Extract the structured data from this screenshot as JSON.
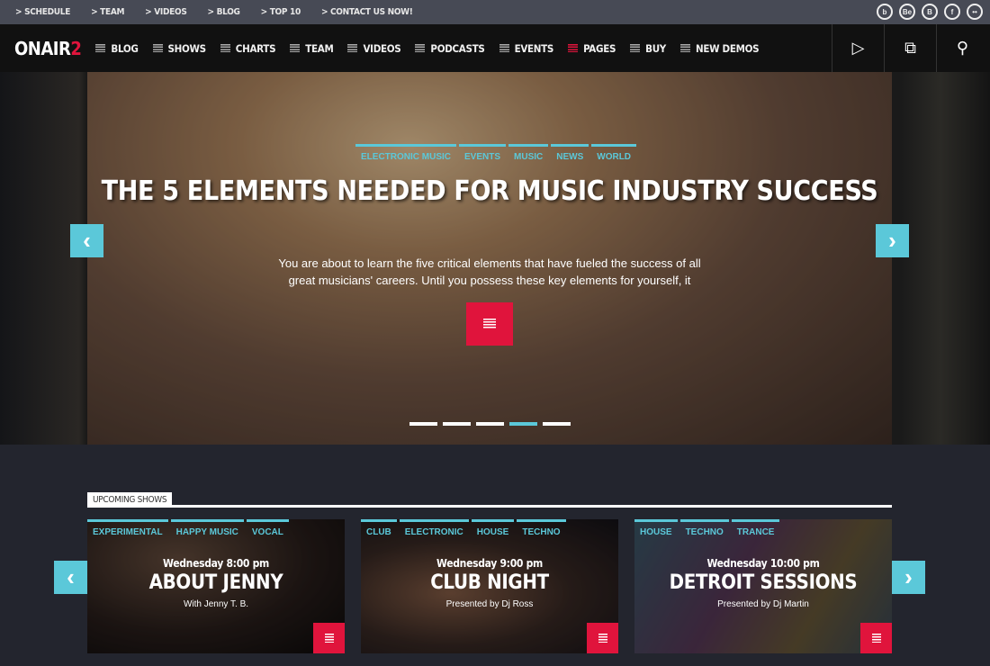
{
  "topbar": {
    "links": [
      "> SCHEDULE",
      "> TEAM",
      "> VIDEOS",
      "> BLOG",
      "> TOP 10",
      "> CONTACT US NOW!"
    ],
    "socials": [
      {
        "icon": "b-icon",
        "glyph": "b"
      },
      {
        "icon": "behance-icon",
        "glyph": "Be"
      },
      {
        "icon": "blogger-icon",
        "glyph": "B"
      },
      {
        "icon": "facebook-icon",
        "glyph": "f"
      },
      {
        "icon": "flickr-icon",
        "glyph": "••"
      }
    ]
  },
  "nav": {
    "logo_main": "ONAIR",
    "logo_accent": "2",
    "items": [
      "BLOG",
      "SHOWS",
      "CHARTS",
      "TEAM",
      "VIDEOS",
      "PODCASTS",
      "EVENTS",
      "PAGES",
      "BUY",
      "NEW DEMOS"
    ],
    "active": "PAGES",
    "buttons": [
      {
        "icon": "play-icon",
        "glyph": "▷"
      },
      {
        "icon": "copy-icon",
        "glyph": "⧉"
      },
      {
        "icon": "search-icon",
        "glyph": "⚲"
      }
    ]
  },
  "hero": {
    "tags": [
      "ELECTRONIC MUSIC",
      "EVENTS",
      "MUSIC",
      "NEWS",
      "WORLD"
    ],
    "title": "THE 5 ELEMENTS NEEDED FOR MUSIC INDUSTRY SUCCESS",
    "excerpt": "You are about to learn the five critical elements that have fueled the success of all great musicians' careers. Until you possess these key elements for yourself, it",
    "slides": 5,
    "active_slide": 4
  },
  "upcoming": {
    "heading": "UPCOMING SHOWS",
    "shows": [
      {
        "tags": [
          "EXPERIMENTAL",
          "HAPPY MUSIC",
          "VOCAL"
        ],
        "time": "Wednesday 8:00 pm",
        "title": "ABOUT JENNY",
        "host": "With Jenny T. B."
      },
      {
        "tags": [
          "CLUB",
          "ELECTRONIC",
          "HOUSE",
          "TECHNO"
        ],
        "time": "Wednesday 9:00 pm",
        "title": "CLUB NIGHT",
        "host": "Presented by Dj Ross"
      },
      {
        "tags": [
          "HOUSE",
          "TECHNO",
          "TRANCE"
        ],
        "time": "Wednesday 10:00 pm",
        "title": "DETROIT SESSIONS",
        "host": "Presented by Dj Martin"
      }
    ]
  },
  "colors": {
    "accent": "#5bc8d9",
    "red": "#e0143c",
    "topbar": "#474a55",
    "nav": "#111111",
    "background": "#23252e"
  }
}
